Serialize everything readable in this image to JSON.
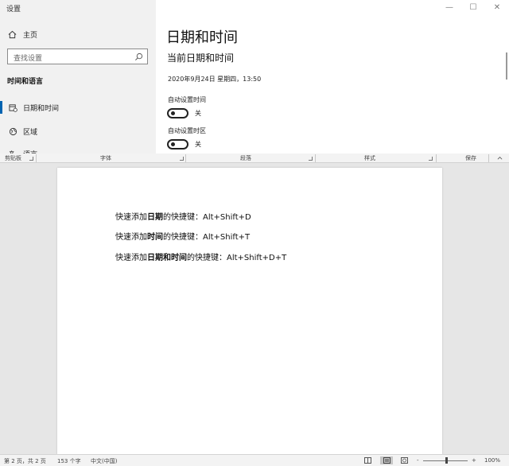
{
  "settings": {
    "window_title": "设置",
    "sidebar": {
      "home_label": "主页",
      "search_placeholder": "查找设置",
      "section_title": "时间和语言",
      "items": [
        {
          "label": "日期和时间",
          "icon": "clock-calendar-icon",
          "active": true
        },
        {
          "label": "区域",
          "icon": "globe-icon",
          "active": false
        },
        {
          "label": "语言",
          "icon": "language-icon",
          "active": false
        }
      ]
    },
    "window_controls": {
      "minimize": "—",
      "maximize": "☐",
      "close": "✕"
    },
    "main": {
      "page_title": "日期和时间",
      "section_title": "当前日期和时间",
      "current_datetime": "2020年9月24日 星期四，13:50",
      "auto_time": {
        "label": "自动设置时间",
        "state": "关"
      },
      "auto_timezone": {
        "label": "自动设置时区",
        "state": "关"
      }
    }
  },
  "word": {
    "ribbon_groups": [
      "剪贴板",
      "字体",
      "段落",
      "样式",
      "保存"
    ],
    "document_lines": [
      {
        "pre": "快速添加",
        "bold": "日期",
        "post": "的快捷键：Alt+Shift+D"
      },
      {
        "pre": "快速添加",
        "bold": "时间",
        "post": "的快捷键：Alt+Shift+T"
      },
      {
        "pre": "快速添加",
        "bold": "日期和时间",
        "post": "的快捷键：Alt+Shift+D+T"
      }
    ],
    "status_bar": {
      "page_info": "第 2 页，共 2 页",
      "word_count": "153 个字",
      "language": "中文(中国)",
      "zoom_minus": "-",
      "zoom_plus": "+",
      "zoom_level": "100%"
    }
  },
  "colors": {
    "accent": "#0063b1",
    "sidebar_bg": "#f1f1f1",
    "doc_bg": "#e6e6e6"
  }
}
